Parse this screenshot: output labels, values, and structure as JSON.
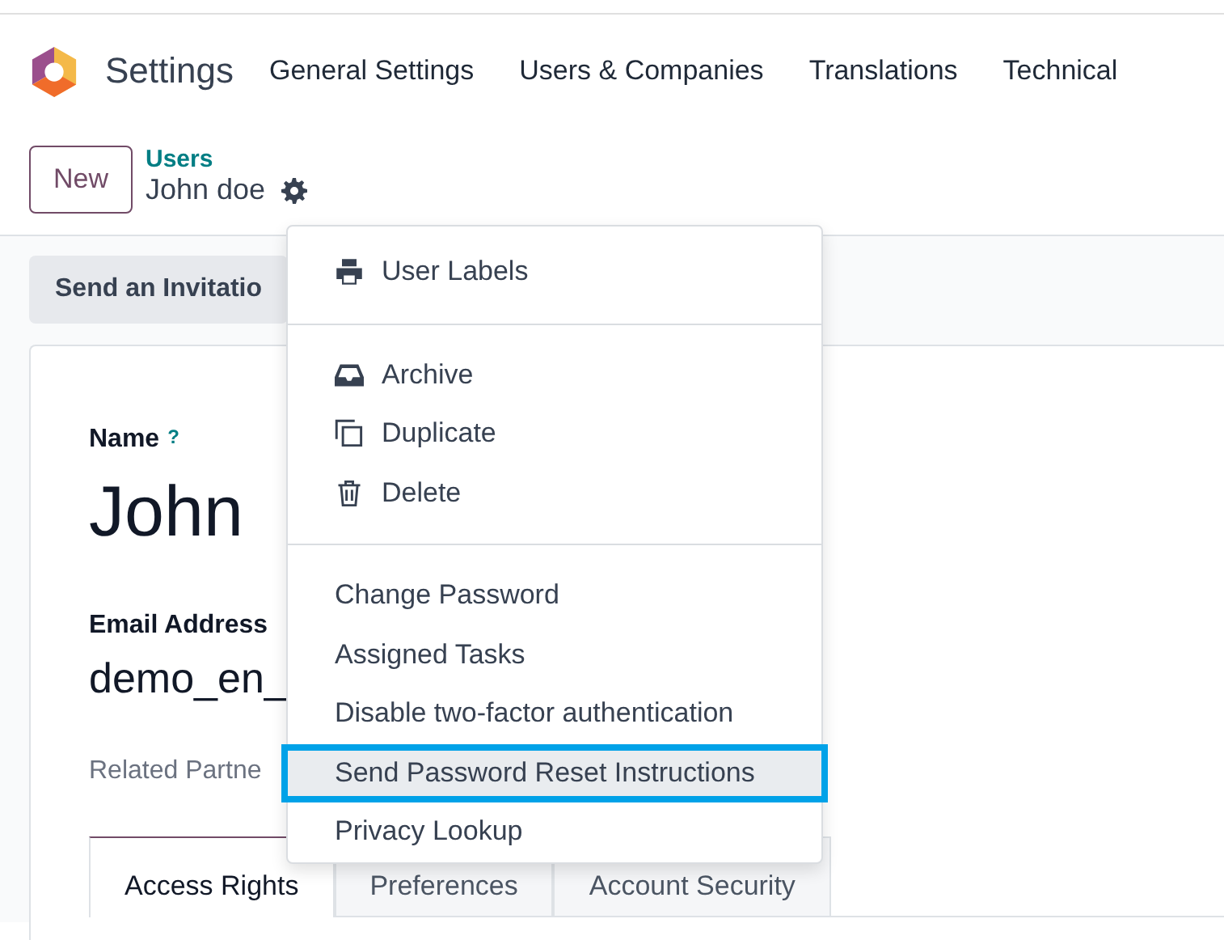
{
  "navbar": {
    "app_name": "Settings",
    "menu": [
      "General Settings",
      "Users & Companies",
      "Translations",
      "Technical"
    ]
  },
  "control_panel": {
    "new_button": "New",
    "breadcrumb": "Users",
    "record": "John doe"
  },
  "action_button": "Send an Invitatio",
  "form": {
    "name_label": "Name",
    "name_help": "?",
    "name_value": "John",
    "email_label": "Email Address",
    "email_value": "demo_en_",
    "partner_label": "Related Partne",
    "tabs": [
      {
        "label": "Access Rights",
        "selected": true
      },
      {
        "label": "Preferences",
        "selected": false
      },
      {
        "label": "Account Security",
        "selected": false
      }
    ]
  },
  "dropdown": {
    "sections": [
      [
        {
          "label": "User Labels",
          "kind": "print",
          "selected": false
        }
      ],
      [
        {
          "label": "Archive",
          "kind": "archive",
          "selected": false
        },
        {
          "label": "Duplicate",
          "kind": "duplicate",
          "selected": false
        },
        {
          "label": "Delete",
          "kind": "delete",
          "selected": false
        }
      ],
      [
        {
          "label": "Change Password",
          "kind": "plain",
          "selected": false
        },
        {
          "label": "Assigned Tasks",
          "kind": "plain",
          "selected": false
        },
        {
          "label": "Disable two-factor authentication",
          "kind": "plain",
          "selected": false
        },
        {
          "label": "Send Password Reset Instructions",
          "kind": "plain",
          "selected": true
        },
        {
          "label": "Privacy Lookup",
          "kind": "plain",
          "selected": false
        }
      ]
    ]
  }
}
